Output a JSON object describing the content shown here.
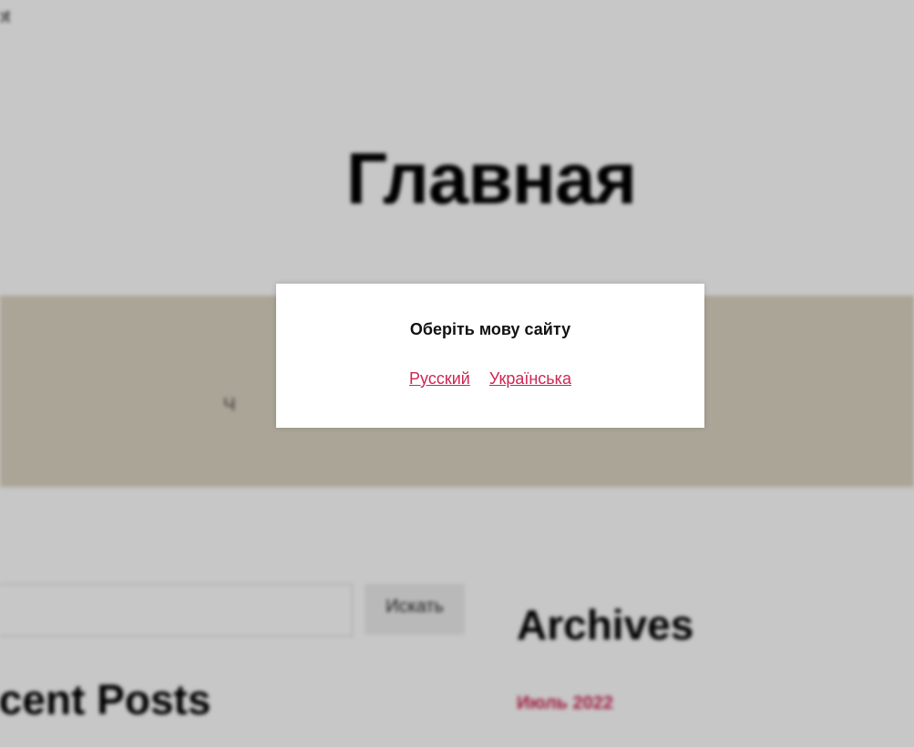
{
  "page": {
    "corner_text": "ot",
    "hero_title": "Главная",
    "band_meta": "Ч",
    "search_button_label": "Искать",
    "recent_posts_heading": "Recent Posts",
    "archives_heading": "Archives",
    "archive_link": "Июль 2022"
  },
  "modal": {
    "title": "Оберіть мову сайту",
    "options": [
      "Русский",
      "Українська"
    ]
  },
  "colors": {
    "accent": "#cd2653",
    "band": "#dcd4c2",
    "overlay": "rgba(0,0,0,0.22)"
  }
}
